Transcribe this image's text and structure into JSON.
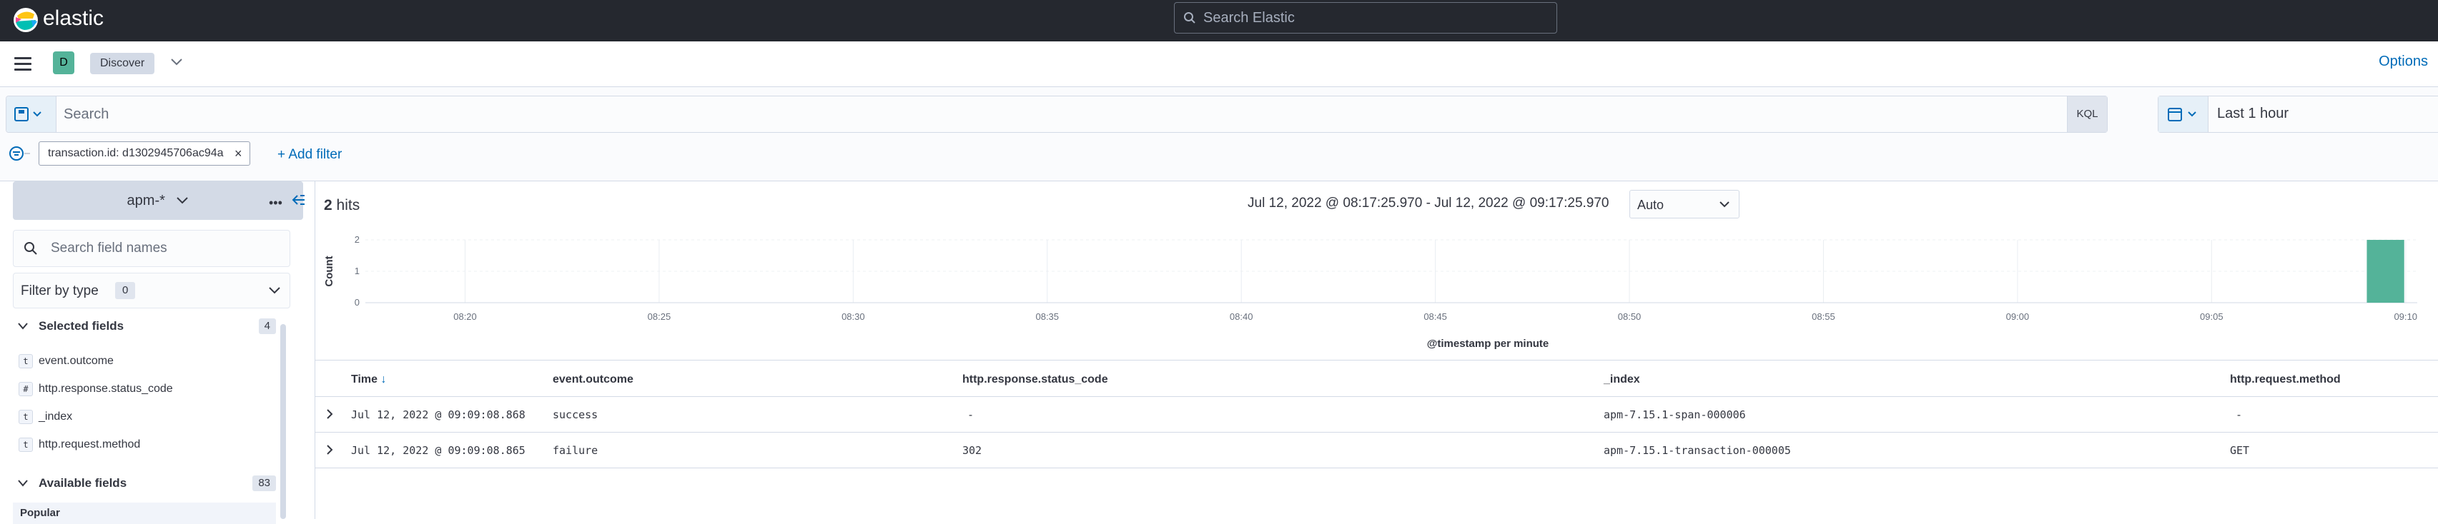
{
  "header": {
    "brand": "elastic",
    "search_placeholder": "Search Elastic"
  },
  "nav": {
    "avatar_letter": "D",
    "breadcrumb": "Discover",
    "options_label": "Options"
  },
  "query": {
    "placeholder": "Search",
    "language": "KQL",
    "date_label": "Last 1 hour"
  },
  "filters": {
    "pill": "transaction.id: d1302945706ac94a",
    "add_label": "+ Add filter"
  },
  "sidebar": {
    "index_pattern": "apm-*",
    "field_search_placeholder": "Search field names",
    "filter_by_type": "Filter by type",
    "filter_count": "0",
    "selected_title": "Selected fields",
    "selected_count": "4",
    "selected_fields": [
      {
        "type": "t",
        "name": "event.outcome"
      },
      {
        "type": "#",
        "name": "http.response.status_code"
      },
      {
        "type": "t",
        "name": "_index"
      },
      {
        "type": "t",
        "name": "http.request.method"
      }
    ],
    "available_title": "Available fields",
    "available_count": "83",
    "popular_label": "Popular"
  },
  "results": {
    "hits_count": "2",
    "hits_label": "hits",
    "time_range": "Jul 12, 2022 @ 08:17:25.970 - Jul 12, 2022 @ 09:17:25.970",
    "interval": "Auto"
  },
  "chart_data": {
    "type": "bar",
    "ylabel": "Count",
    "xlabel": "@timestamp per minute",
    "yticks": [
      "2",
      "1",
      "0"
    ],
    "ylim": [
      0,
      2
    ],
    "xticks": [
      "08:20",
      "08:25",
      "08:30",
      "08:35",
      "08:40",
      "08:45",
      "08:50",
      "08:55",
      "09:00",
      "09:05",
      "09:10"
    ],
    "bars": [
      {
        "x": "09:09",
        "value": 2
      }
    ],
    "color": "#54b399"
  },
  "table": {
    "columns": [
      "Time",
      "event.outcome",
      "http.response.status_code",
      "_index",
      "http.request.method"
    ],
    "rows": [
      [
        "Jul 12, 2022 @ 09:09:08.868",
        "success",
        "-",
        "apm-7.15.1-span-000006",
        "-"
      ],
      [
        "Jul 12, 2022 @ 09:09:08.865",
        "failure",
        "302",
        "apm-7.15.1-transaction-000005",
        "GET"
      ]
    ]
  }
}
